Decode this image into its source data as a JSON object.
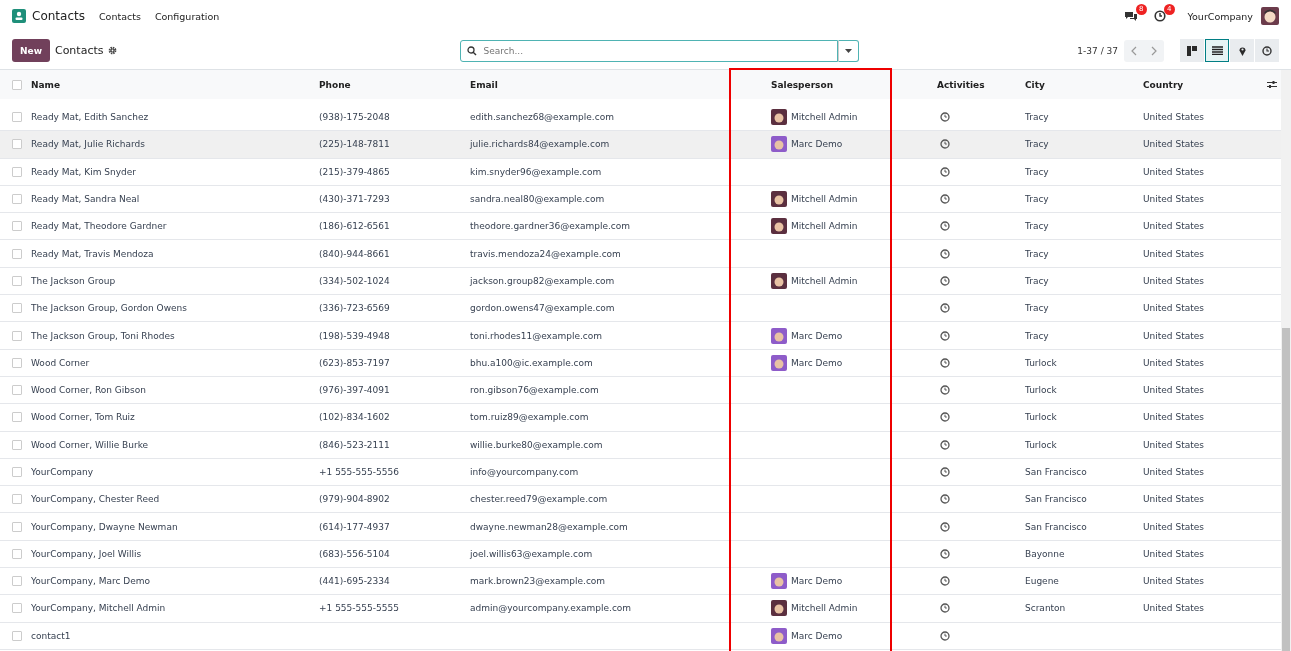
{
  "navbar": {
    "app_name": "Contacts",
    "menus": [
      "Contacts",
      "Configuration"
    ],
    "messages_count": "8",
    "activities_count": "4",
    "company": "YourCompany"
  },
  "control_panel": {
    "new_button": "New",
    "breadcrumb": "Contacts",
    "search": {
      "placeholder": "Search..."
    },
    "pager": "1-37 / 37",
    "views": [
      {
        "kind": "kanban",
        "selected": false
      },
      {
        "kind": "list",
        "selected": true
      },
      {
        "kind": "map",
        "selected": false
      },
      {
        "kind": "activity",
        "selected": false
      }
    ]
  },
  "table": {
    "all_checked": false,
    "columns": [
      "Name",
      "Phone",
      "Email",
      "Salesperson",
      "Activities",
      "City",
      "Country"
    ],
    "rows": [
      {
        "name": "Ready Mat, Edith Sanchez",
        "phone": "(938)-175-2048",
        "email": "edith.sanchez68@example.com",
        "salesperson": {
          "name": "Mitchell Admin",
          "color": "#5b2f3f"
        },
        "city": "Tracy",
        "country": "United States",
        "hovered": false
      },
      {
        "name": "Ready Mat, Julie Richards",
        "phone": "(225)-148-7811",
        "email": "julie.richards84@example.com",
        "salesperson": {
          "name": "Marc Demo",
          "color": "#8e5cc9"
        },
        "city": "Tracy",
        "country": "United States",
        "hovered": true
      },
      {
        "name": "Ready Mat, Kim Snyder",
        "phone": "(215)-379-4865",
        "email": "kim.snyder96@example.com",
        "salesperson": null,
        "city": "Tracy",
        "country": "United States",
        "hovered": false
      },
      {
        "name": "Ready Mat, Sandra Neal",
        "phone": "(430)-371-7293",
        "email": "sandra.neal80@example.com",
        "salesperson": {
          "name": "Mitchell Admin",
          "color": "#5b2f3f"
        },
        "city": "Tracy",
        "country": "United States",
        "hovered": false
      },
      {
        "name": "Ready Mat, Theodore Gardner",
        "phone": "(186)-612-6561",
        "email": "theodore.gardner36@example.com",
        "salesperson": {
          "name": "Mitchell Admin",
          "color": "#5b2f3f"
        },
        "city": "Tracy",
        "country": "United States",
        "hovered": false
      },
      {
        "name": "Ready Mat, Travis Mendoza",
        "phone": "(840)-944-8661",
        "email": "travis.mendoza24@example.com",
        "salesperson": null,
        "city": "Tracy",
        "country": "United States",
        "hovered": false
      },
      {
        "name": "The Jackson Group",
        "phone": "(334)-502-1024",
        "email": "jackson.group82@example.com",
        "salesperson": {
          "name": "Mitchell Admin",
          "color": "#5b2f3f"
        },
        "city": "Tracy",
        "country": "United States",
        "hovered": false
      },
      {
        "name": "The Jackson Group, Gordon Owens",
        "phone": "(336)-723-6569",
        "email": "gordon.owens47@example.com",
        "salesperson": null,
        "city": "Tracy",
        "country": "United States",
        "hovered": false
      },
      {
        "name": "The Jackson Group, Toni Rhodes",
        "phone": "(198)-539-4948",
        "email": "toni.rhodes11@example.com",
        "salesperson": {
          "name": "Marc Demo",
          "color": "#8e5cc9"
        },
        "city": "Tracy",
        "country": "United States",
        "hovered": false
      },
      {
        "name": "Wood Corner",
        "phone": "(623)-853-7197",
        "email": "bhu.a100@ic.example.com",
        "salesperson": {
          "name": "Marc Demo",
          "color": "#8e5cc9"
        },
        "city": "Turlock",
        "country": "United States",
        "hovered": false
      },
      {
        "name": "Wood Corner, Ron Gibson",
        "phone": "(976)-397-4091",
        "email": "ron.gibson76@example.com",
        "salesperson": null,
        "city": "Turlock",
        "country": "United States",
        "hovered": false
      },
      {
        "name": "Wood Corner, Tom Ruiz",
        "phone": "(102)-834-1602",
        "email": "tom.ruiz89@example.com",
        "salesperson": null,
        "city": "Turlock",
        "country": "United States",
        "hovered": false
      },
      {
        "name": "Wood Corner, Willie Burke",
        "phone": "(846)-523-2111",
        "email": "willie.burke80@example.com",
        "salesperson": null,
        "city": "Turlock",
        "country": "United States",
        "hovered": false
      },
      {
        "name": "YourCompany",
        "phone": "+1 555-555-5556",
        "email": "info@yourcompany.com",
        "salesperson": null,
        "city": "San Francisco",
        "country": "United States",
        "hovered": false
      },
      {
        "name": "YourCompany, Chester Reed",
        "phone": "(979)-904-8902",
        "email": "chester.reed79@example.com",
        "salesperson": null,
        "city": "San Francisco",
        "country": "United States",
        "hovered": false
      },
      {
        "name": "YourCompany, Dwayne Newman",
        "phone": "(614)-177-4937",
        "email": "dwayne.newman28@example.com",
        "salesperson": null,
        "city": "San Francisco",
        "country": "United States",
        "hovered": false
      },
      {
        "name": "YourCompany, Joel Willis",
        "phone": "(683)-556-5104",
        "email": "joel.willis63@example.com",
        "salesperson": null,
        "city": "Bayonne",
        "country": "United States",
        "hovered": false
      },
      {
        "name": "YourCompany, Marc Demo",
        "phone": "(441)-695-2334",
        "email": "mark.brown23@example.com",
        "salesperson": {
          "name": "Marc Demo",
          "color": "#8e5cc9"
        },
        "city": "Eugene",
        "country": "United States",
        "hovered": false
      },
      {
        "name": "YourCompany, Mitchell Admin",
        "phone": "+1 555-555-5555",
        "email": "admin@yourcompany.example.com",
        "salesperson": {
          "name": "Mitchell Admin",
          "color": "#5b2f3f"
        },
        "city": "Scranton",
        "country": "United States",
        "hovered": false
      },
      {
        "name": "contact1",
        "phone": "",
        "email": "",
        "salesperson": {
          "name": "Marc Demo",
          "color": "#8e5cc9"
        },
        "city": "",
        "country": "",
        "hovered": false
      }
    ]
  }
}
